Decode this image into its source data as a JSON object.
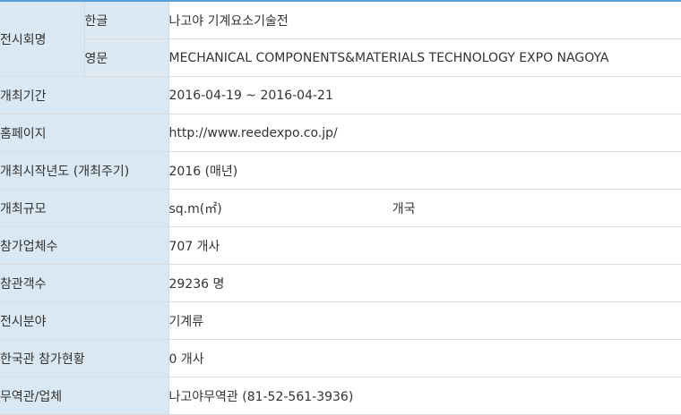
{
  "rows": {
    "exhibition_name": {
      "label": "전시회명",
      "korean_label": "한글",
      "korean_value": "나고야 기계요소기술전",
      "english_label": "영문",
      "english_value": "MECHANICAL COMPONENTS&MATERIALS TECHNOLOGY EXPO NAGOYA"
    },
    "period": {
      "label": "개최기간",
      "value": "2016-04-19 ~ 2016-04-21"
    },
    "homepage": {
      "label": "홈페이지",
      "value": "http://www.reedexpo.co.jp/"
    },
    "start_year": {
      "label": "개최시작년도 (개최주기)",
      "value": "2016 (매년)"
    },
    "scale": {
      "label": "개최규모",
      "area": "sq.m(㎡)",
      "countries": "개국"
    },
    "exhibitors": {
      "label": "참가업체수",
      "value": "707 개사"
    },
    "visitors": {
      "label": "참관객수",
      "value": "29236 명"
    },
    "field": {
      "label": "전시분야",
      "value": "기계류"
    },
    "korea_pavilion": {
      "label": "한국관 참가현황",
      "value": "0 개사"
    },
    "trade_office": {
      "label": "무역관/업체",
      "value": "나고야무역관 (81-52-561-3936)"
    }
  }
}
